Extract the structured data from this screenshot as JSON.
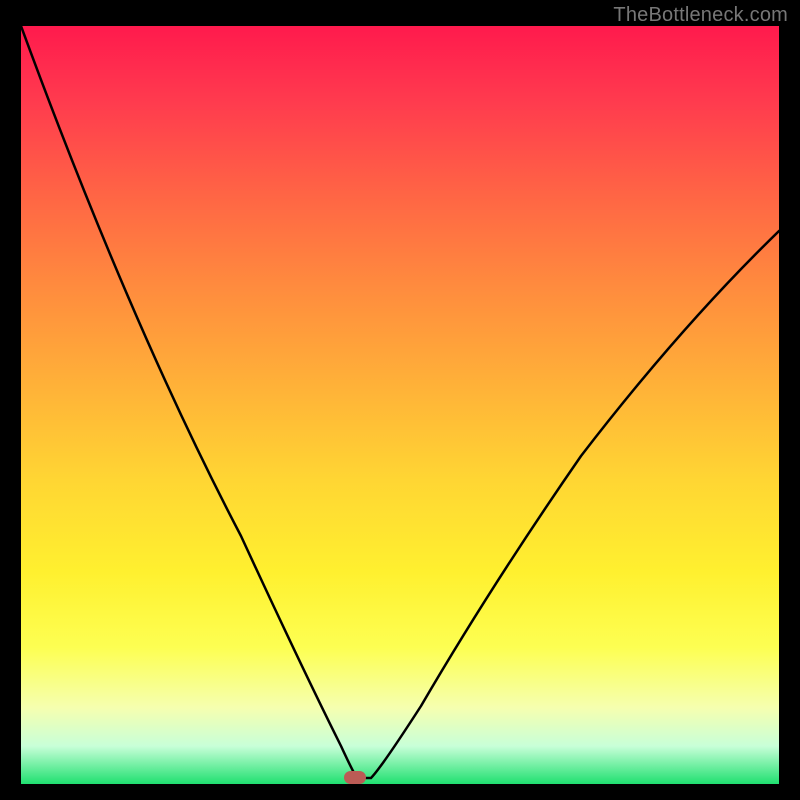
{
  "watermark": "TheBottleneck.com",
  "chart_data": {
    "type": "line",
    "title": "",
    "xlabel": "",
    "ylabel": "",
    "xlim": [
      0,
      1
    ],
    "ylim": [
      0,
      1
    ],
    "series": [
      {
        "name": "curve",
        "x": [
          0.0,
          0.05,
          0.1,
          0.15,
          0.2,
          0.25,
          0.3,
          0.35,
          0.4,
          0.425,
          0.44,
          0.46,
          0.5,
          0.55,
          0.6,
          0.65,
          0.7,
          0.75,
          0.8,
          0.85,
          0.9,
          0.95,
          1.0
        ],
        "y": [
          1.0,
          0.84,
          0.69,
          0.56,
          0.44,
          0.33,
          0.23,
          0.14,
          0.06,
          0.02,
          0.0,
          0.0,
          0.02,
          0.08,
          0.16,
          0.25,
          0.34,
          0.43,
          0.51,
          0.58,
          0.64,
          0.69,
          0.73
        ]
      }
    ],
    "marker": {
      "x": 0.44,
      "y": 0.0
    },
    "background": {
      "top_color": "#ff1a4d",
      "bottom_color": "#20e070"
    }
  }
}
